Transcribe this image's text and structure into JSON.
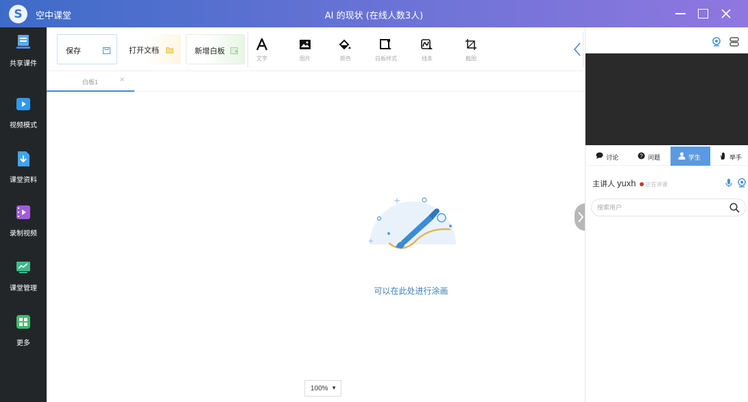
{
  "app": {
    "name": "空中课堂",
    "window_title": "AI 的现状 (在线人数3人)"
  },
  "leftnav": {
    "items": [
      {
        "label": "共享课件",
        "icon": "courseware-icon"
      },
      {
        "label": "视频模式",
        "icon": "video-play-icon"
      },
      {
        "label": "课堂资料",
        "icon": "download-doc-icon"
      },
      {
        "label": "录制视频",
        "icon": "record-film-icon"
      },
      {
        "label": "课堂管理",
        "icon": "monitor-chart-icon"
      },
      {
        "label": "更多",
        "icon": "grid-more-icon"
      }
    ]
  },
  "toolbar": {
    "save_label": "保存",
    "open_doc_label": "打开文档",
    "new_board_label": "新增白板",
    "tools": [
      {
        "label": "文字",
        "icon": "text-icon"
      },
      {
        "label": "图片",
        "icon": "image-icon"
      },
      {
        "label": "颜色",
        "icon": "fill-bucket-icon"
      },
      {
        "label": "白板样式",
        "icon": "board-style-icon"
      },
      {
        "label": "线条",
        "icon": "line-icon"
      },
      {
        "label": "截图",
        "icon": "crop-icon"
      }
    ]
  },
  "tabs": [
    {
      "label": "白板1",
      "close": "×"
    }
  ],
  "canvas": {
    "empty_text": "可以在此处进行涂画",
    "zoom": "100%"
  },
  "rightpanel": {
    "tabs": [
      {
        "label": "讨论",
        "icon": "chat-bubble-icon"
      },
      {
        "label": "问题",
        "icon": "question-icon"
      },
      {
        "label": "学生",
        "icon": "user-icon",
        "active": true
      },
      {
        "label": "举手",
        "icon": "raise-hand-icon"
      }
    ],
    "speaker": {
      "role": "主讲人",
      "name": "yuxh",
      "status": "正在讲课"
    },
    "search_placeholder": "搜索用户"
  },
  "colors": {
    "titlebar_start": "#3d6cc8",
    "titlebar_end": "#8f77df",
    "nav_bg": "#232629",
    "accent": "#3b8bd6",
    "active_tab": "#5b9ae0"
  }
}
